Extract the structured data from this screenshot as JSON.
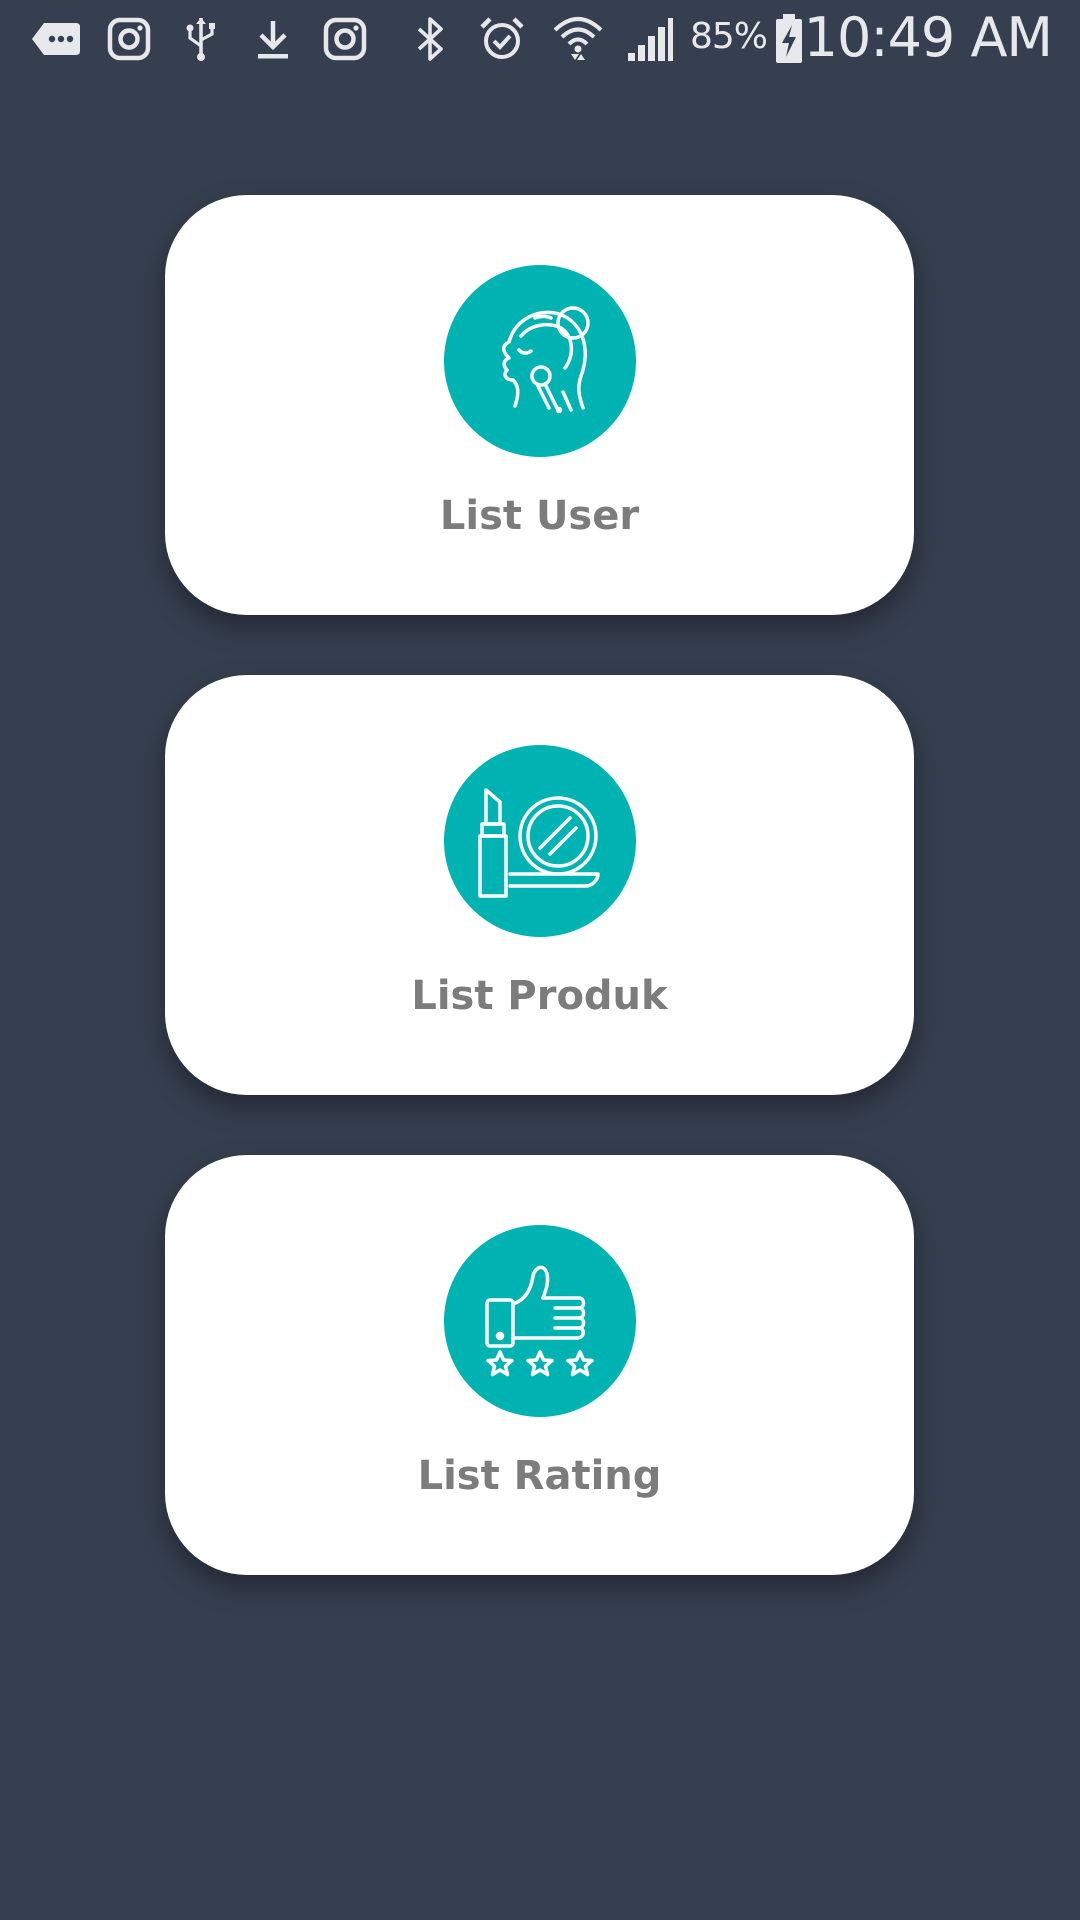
{
  "status_bar": {
    "icons": [
      "message-icon",
      "instagram-icon",
      "usb-icon",
      "download-icon",
      "instagram-icon",
      "bluetooth-icon",
      "alarm-icon",
      "wifi-icon",
      "signal-icon",
      "battery-charging-icon"
    ],
    "battery_percent": "85%",
    "time": "10:49 AM"
  },
  "menu": {
    "items": [
      {
        "label": "List User",
        "icon": "user-face-icon"
      },
      {
        "label": "List Produk",
        "icon": "cosmetics-icon"
      },
      {
        "label": "List Rating",
        "icon": "thumbs-up-rating-icon"
      }
    ]
  },
  "colors": {
    "background": "#363f4f",
    "card": "#ffffff",
    "icon_circle": "#00b3b3",
    "label": "#7c7c7c",
    "status_text": "#e6e8ec"
  }
}
